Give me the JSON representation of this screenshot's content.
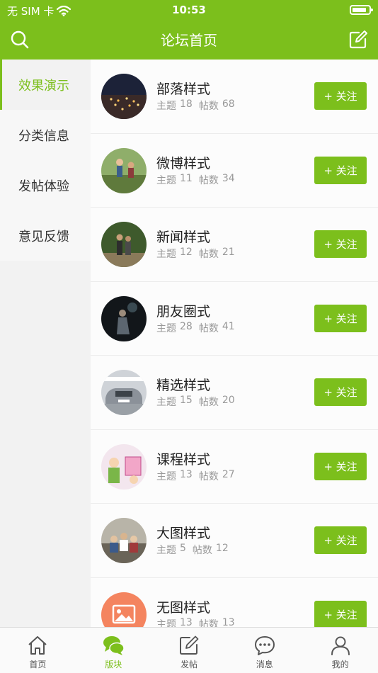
{
  "status_bar": {
    "carrier": "无 SIM 卡",
    "time": "10:53",
    "battery_level": 0.85
  },
  "nav": {
    "title": "论坛首页",
    "left_icon": "search-icon",
    "right_icon": "compose-icon"
  },
  "sidebar": {
    "items": [
      {
        "label": "效果演示",
        "active": true
      },
      {
        "label": "分类信息",
        "active": false
      },
      {
        "label": "发帖体验",
        "active": false
      },
      {
        "label": "意见反馈",
        "active": false
      }
    ]
  },
  "forums": [
    {
      "title": "部落样式",
      "topics_label": "主题",
      "topics": "18",
      "posts_label": "帖数",
      "posts": "68",
      "follow_label": "+ 关注",
      "thumb": "city-night"
    },
    {
      "title": "微博样式",
      "topics_label": "主题",
      "topics": "11",
      "posts_label": "帖数",
      "posts": "34",
      "follow_label": "+ 关注",
      "thumb": "hikers"
    },
    {
      "title": "新闻样式",
      "topics_label": "主题",
      "topics": "12",
      "posts_label": "帖数",
      "posts": "21",
      "follow_label": "+ 关注",
      "thumb": "couple-walking"
    },
    {
      "title": "朋友圈式",
      "topics_label": "主题",
      "topics": "28",
      "posts_label": "帖数",
      "posts": "41",
      "follow_label": "+ 关注",
      "thumb": "night-figure"
    },
    {
      "title": "精选样式",
      "topics_label": "主题",
      "topics": "15",
      "posts_label": "帖数",
      "posts": "20",
      "follow_label": "+ 关注",
      "thumb": "car"
    },
    {
      "title": "课程样式",
      "topics_label": "主题",
      "topics": "13",
      "posts_label": "帖数",
      "posts": "27",
      "follow_label": "+ 关注",
      "thumb": "cartoon"
    },
    {
      "title": "大图样式",
      "topics_label": "主题",
      "topics": "5",
      "posts_label": "帖数",
      "posts": "12",
      "follow_label": "+ 关注",
      "thumb": "group-photo"
    },
    {
      "title": "无图样式",
      "topics_label": "主题",
      "topics": "13",
      "posts_label": "帖数",
      "posts": "13",
      "follow_label": "+ 关注",
      "thumb": "image-placeholder"
    }
  ],
  "tabbar": {
    "items": [
      {
        "label": "首页",
        "icon": "home-icon",
        "active": false
      },
      {
        "label": "版块",
        "icon": "chat-bubbles-icon",
        "active": true
      },
      {
        "label": "发帖",
        "icon": "compose-icon",
        "active": false
      },
      {
        "label": "消息",
        "icon": "message-icon",
        "active": false
      },
      {
        "label": "我的",
        "icon": "profile-icon",
        "active": false
      }
    ]
  },
  "colors": {
    "accent": "#7cbf1c",
    "text": "#222222",
    "muted": "#999999",
    "placeholder_orange": "#f4845f"
  }
}
